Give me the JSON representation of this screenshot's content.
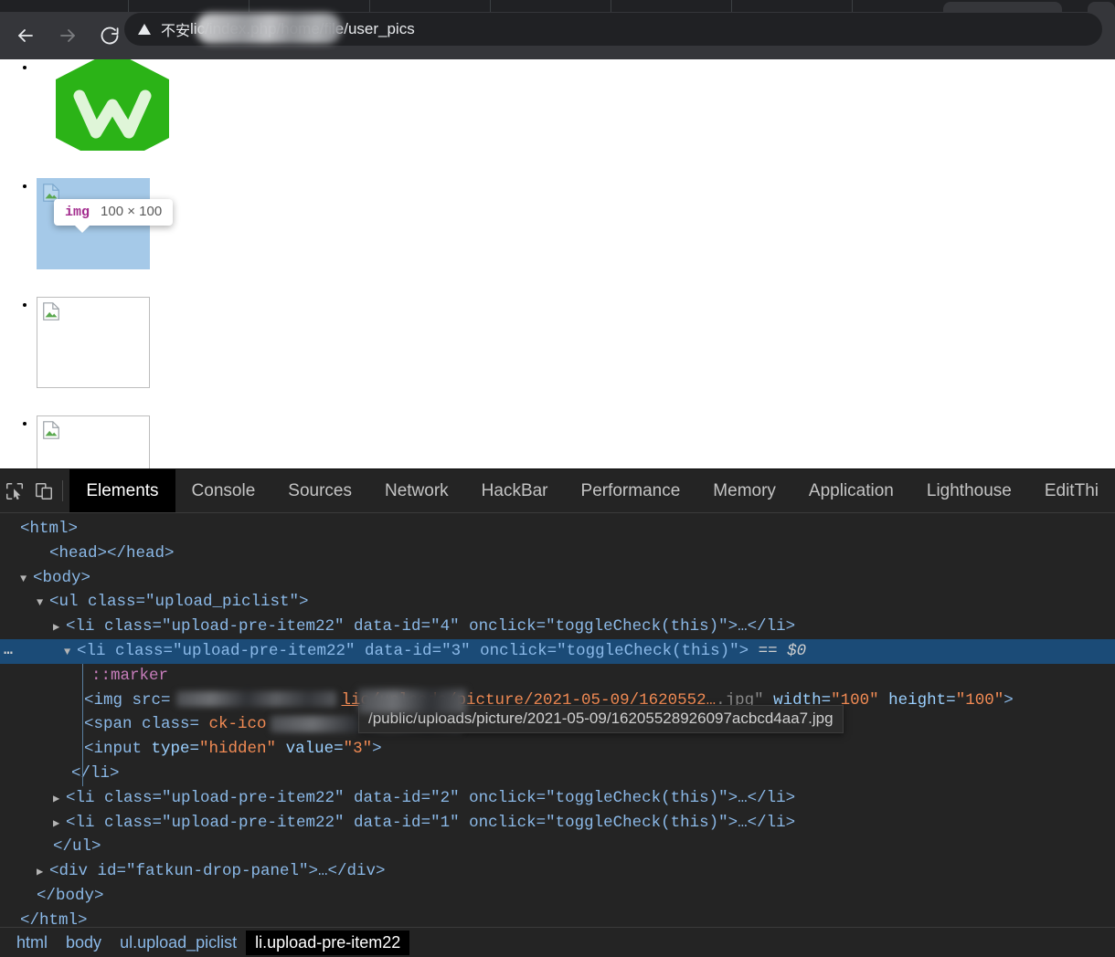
{
  "browser": {
    "back_icon": "back-arrow-icon",
    "forward_icon": "forward-arrow-icon",
    "reload_icon": "reload-icon",
    "security_icon": "warning-triangle-icon",
    "security_label": "不安",
    "url_visible": "lic/index.php/home/file/user_pics",
    "url_redacted": true
  },
  "page": {
    "logo_alt": "wamp-logo",
    "element_tooltip": {
      "tag": "img",
      "dimensions": "100 × 100"
    },
    "items": [
      {
        "state": "logo"
      },
      {
        "state": "selected"
      },
      {
        "state": "broken"
      },
      {
        "state": "broken"
      }
    ]
  },
  "devtools": {
    "toolbar_icons": [
      "inspect-element-icon",
      "device-toolbar-icon"
    ],
    "tabs": [
      {
        "label": "Elements",
        "active": true
      },
      {
        "label": "Console",
        "active": false
      },
      {
        "label": "Sources",
        "active": false
      },
      {
        "label": "Network",
        "active": false
      },
      {
        "label": "HackBar",
        "active": false
      },
      {
        "label": "Performance",
        "active": false
      },
      {
        "label": "Memory",
        "active": false
      },
      {
        "label": "Application",
        "active": false
      },
      {
        "label": "Lighthouse",
        "active": false
      },
      {
        "label": "EditThi",
        "active": false
      }
    ],
    "tree": {
      "html_open": "<html>",
      "head": "<head></head>",
      "body_open": "<body>",
      "ul_open": "<ul class=\"upload_piclist\">",
      "li4": "<li class=\"upload-pre-item22\" data-id=\"4\" onclick=\"toggleCheck(this)\">…</li>",
      "li3_open": "<li class=\"upload-pre-item22\" data-id=\"3\" onclick=\"toggleCheck(this)\">",
      "li3_selected_marker": "== $0",
      "marker": "::marker",
      "img_prefix": "<img src=",
      "img_path_visible": "lic/uploads/picture/2021-05-09/1620552…",
      "img_path_ext": ".jpg\"",
      "img_width_attr": "width=",
      "img_width_val": "\"100\"",
      "img_height_attr": "height=",
      "img_height_val": "\"100\"",
      "img_close": ">",
      "span_prefix": "<span class=",
      "span_class_visible": "ck-ico",
      "input_hidden": "<input type=\"hidden\" value=\"3\">",
      "li3_close": "</li>",
      "li2": "<li class=\"upload-pre-item22\" data-id=\"2\" onclick=\"toggleCheck(this)\">…</li>",
      "li1": "<li class=\"upload-pre-item22\" data-id=\"1\" onclick=\"toggleCheck(this)\">…</li>",
      "ul_close": "</ul>",
      "fatkun": "<div id=\"fatkun-drop-panel\">…</div>",
      "body_close": "</body>",
      "html_close": "</html>"
    },
    "url_tooltip": "/public/uploads/picture/2021-05-09/16205528926097acbcd4aa7.jpg",
    "breadcrumbs": [
      {
        "label": "html",
        "active": false
      },
      {
        "label": "body",
        "active": false
      },
      {
        "label": "ul.upload_piclist",
        "active": false
      },
      {
        "label": "li.upload-pre-item22",
        "active": true
      }
    ]
  },
  "colors": {
    "chrome_toolbar": "#35363a",
    "omnibox": "#202124",
    "devtools_bg": "#242424",
    "selected_row": "#1b4b77",
    "selected_thumb": "#a5c9e8",
    "accent_tag": "#8bb9e8",
    "accent_value": "#f28b54",
    "logo_green": "#2bb317"
  }
}
